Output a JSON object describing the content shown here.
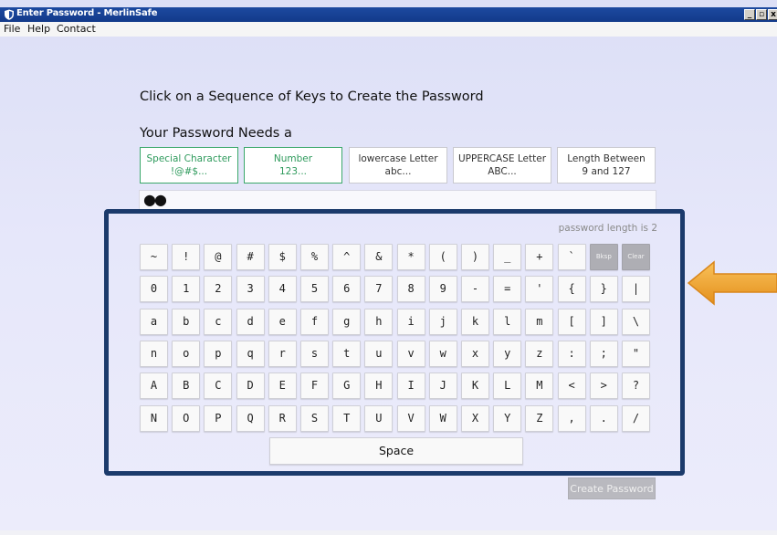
{
  "window": {
    "title": "Enter Password - MerlinSafe",
    "controls": [
      "_",
      "▫",
      "x"
    ]
  },
  "menu": [
    "File",
    "Help",
    "Contact"
  ],
  "instructions": "Click on a Sequence of Keys to Create the Password",
  "requirements_heading": "Your Password Needs a",
  "requirements": [
    {
      "line1": "Special Character",
      "line2": "!@#$...",
      "met": true
    },
    {
      "line1": "Number",
      "line2": "123...",
      "met": true
    },
    {
      "line1": "lowercase Letter",
      "line2": "abc...",
      "met": false
    },
    {
      "line1": "UPPERCASE Letter",
      "line2": "ABC...",
      "met": false
    },
    {
      "line1": "Length Between",
      "line2": "9 and 127",
      "met": false
    }
  ],
  "password_field": {
    "masked_value": "●●"
  },
  "length_label": "password length is 2",
  "keyboard_rows": [
    [
      "~",
      "!",
      "@",
      "#",
      "$",
      "%",
      "^",
      "&",
      "*",
      "(",
      ")",
      "_",
      "+",
      "`",
      "Bksp",
      "Clear"
    ],
    [
      "0",
      "1",
      "2",
      "3",
      "4",
      "5",
      "6",
      "7",
      "8",
      "9",
      "-",
      "=",
      "'",
      "{",
      "}",
      "|"
    ],
    [
      "a",
      "b",
      "c",
      "d",
      "e",
      "f",
      "g",
      "h",
      "i",
      "j",
      "k",
      "l",
      "m",
      "[",
      "]",
      "\\"
    ],
    [
      "n",
      "o",
      "p",
      "q",
      "r",
      "s",
      "t",
      "u",
      "v",
      "w",
      "x",
      "y",
      "z",
      ":",
      ";",
      "\""
    ],
    [
      "A",
      "B",
      "C",
      "D",
      "E",
      "F",
      "G",
      "H",
      "I",
      "J",
      "K",
      "L",
      "M",
      "<",
      ">",
      "?"
    ],
    [
      "N",
      "O",
      "P",
      "Q",
      "R",
      "S",
      "T",
      "U",
      "V",
      "W",
      "X",
      "Y",
      "Z",
      ",",
      ".",
      "/"
    ]
  ],
  "special_keys": [
    "Bksp",
    "Clear"
  ],
  "space_label": "Space",
  "create_button": "Create Password",
  "colors": {
    "frame": "#1b3a6b",
    "met_requirement": "#2e9a5c",
    "arrow": "#f0a030",
    "titlebar": "#1d4aa0"
  },
  "icons": {
    "title": "shield-icon",
    "pointer": "orange-arrow-left"
  }
}
